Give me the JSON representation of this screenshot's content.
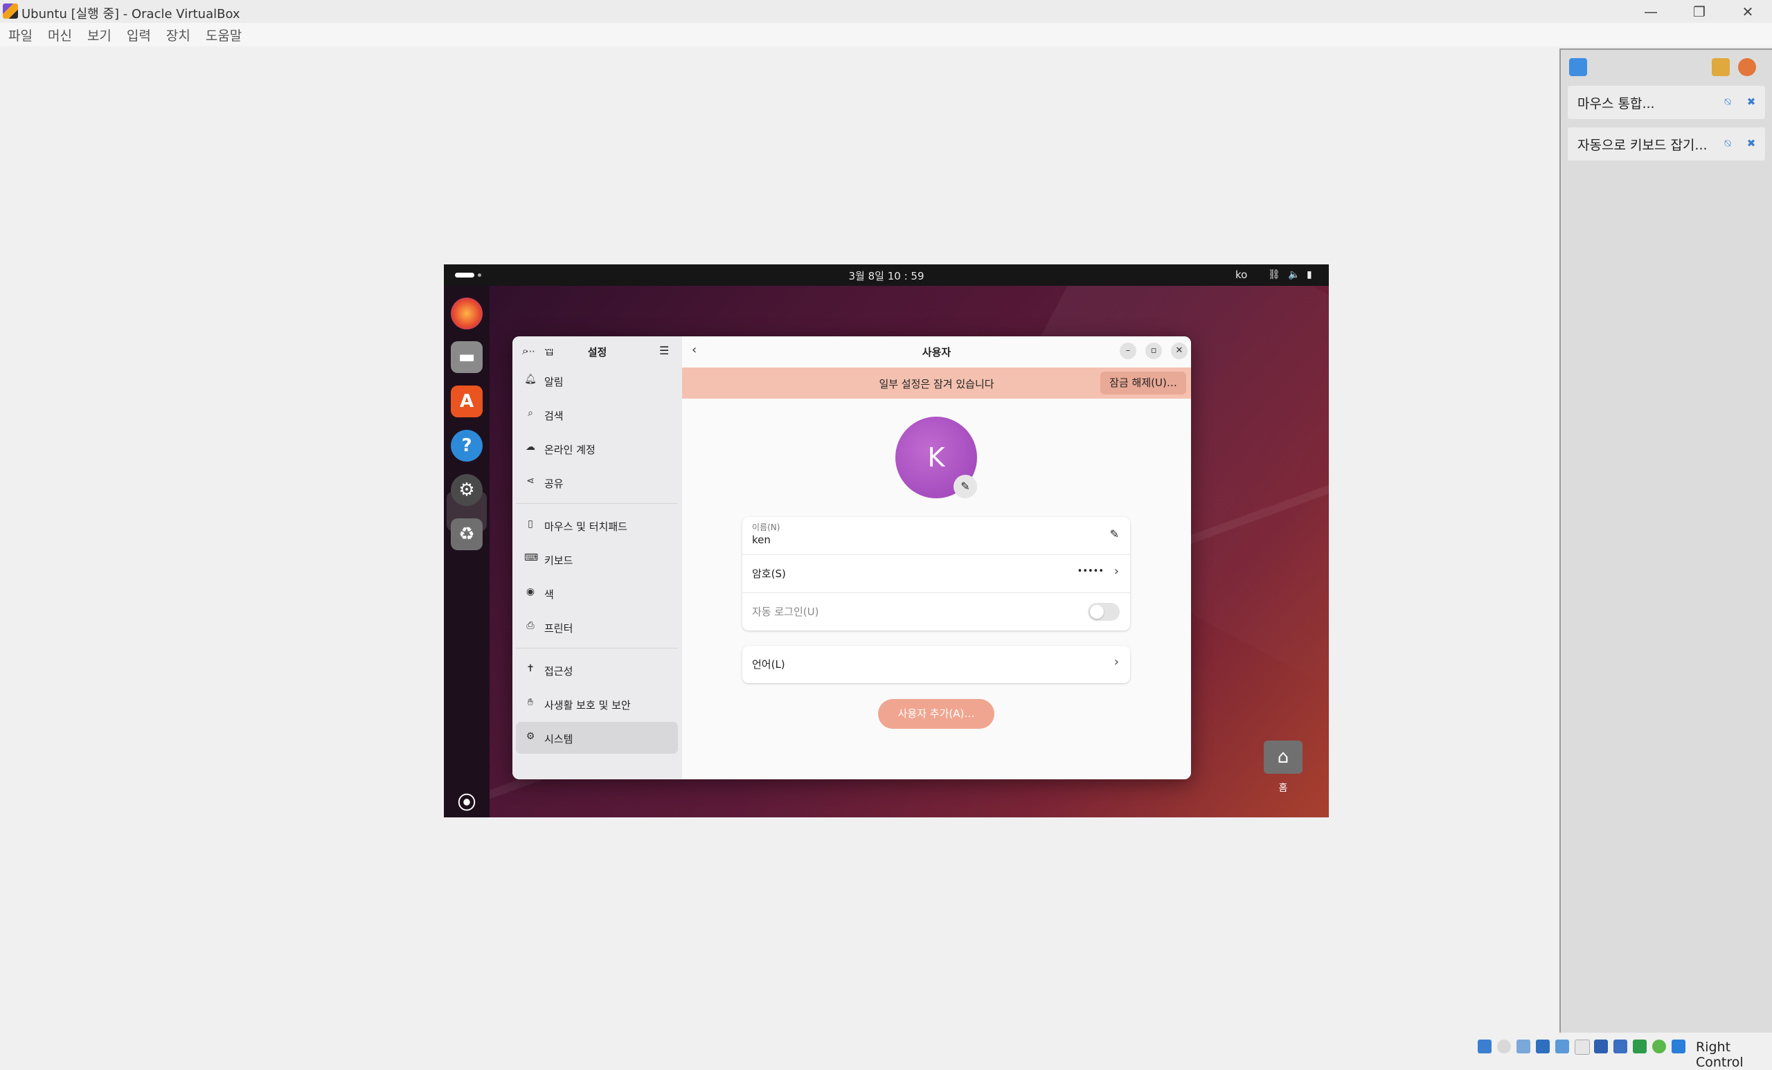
{
  "host": {
    "window_title": "Ubuntu [실행 중] - Oracle VirtualBox",
    "window_controls": [
      "—",
      "❐",
      "✕"
    ],
    "menu": [
      "파일",
      "머신",
      "보기",
      "입력",
      "장치",
      "도움말"
    ],
    "notifications": [
      {
        "text": "마우스 통합..."
      },
      {
        "text": "자동으로 키보드 잡기..."
      }
    ],
    "host_key": "Right Control"
  },
  "vm": {
    "topbar": {
      "clock": "3월 8일  10 : 59",
      "lang": "ko"
    },
    "desktop_icon_label": "홈",
    "settings": {
      "sidebar_title": "설정",
      "sidebar_items": [
        {
          "label": "앱",
          "icon": "apps-icon"
        },
        {
          "label": "알림",
          "icon": "bell-icon"
        },
        {
          "label": "검색",
          "icon": "search-icon"
        },
        {
          "label": "온라인 계정",
          "icon": "cloud-icon"
        },
        {
          "label": "공유",
          "icon": "share-icon"
        },
        {
          "label": "마우스 및 터치패드",
          "icon": "mouse-icon"
        },
        {
          "label": "키보드",
          "icon": "keyboard-icon"
        },
        {
          "label": "색",
          "icon": "color-icon"
        },
        {
          "label": "프린터",
          "icon": "printer-icon"
        },
        {
          "label": "접근성",
          "icon": "accessibility-icon"
        },
        {
          "label": "사생활 보호 및 보안",
          "icon": "hand-icon"
        },
        {
          "label": "시스템",
          "icon": "gear-icon"
        }
      ],
      "main_title": "사용자",
      "banner_text": "일부 설정은 잠겨 있습니다",
      "unlock_label": "잠금 해제(U)…",
      "avatar_letter": "K",
      "name_caption": "이름(N)",
      "name_value": "ken",
      "password_label": "암호(S)",
      "password_mask": "•••••",
      "autologin_label": "자동 로그인(U)",
      "language_label": "언어(L)",
      "add_user_label": "사용자 추가(A)…"
    }
  }
}
